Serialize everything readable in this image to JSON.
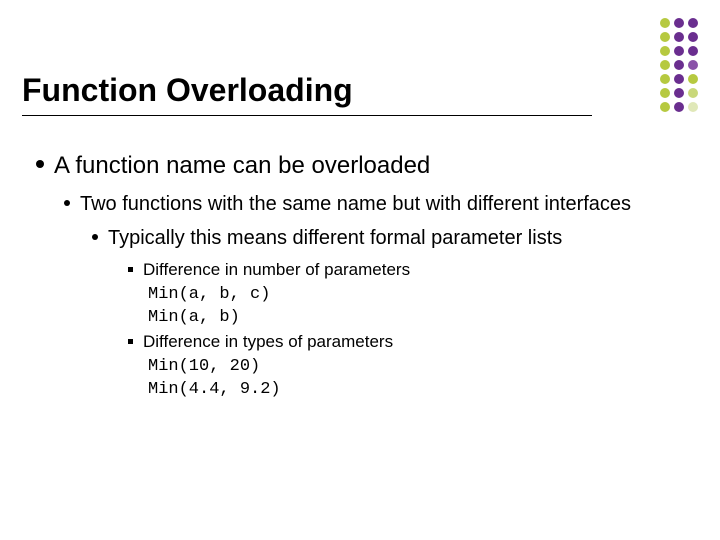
{
  "title": "Function Overloading",
  "l1": "A function name can be overloaded",
  "l2": "Two functions with the same name but with different interfaces",
  "l3": "Typically this means different formal parameter lists",
  "l4a": "Difference in number of parameters",
  "l4a_ex1": "Min(a, b, c)",
  "l4a_ex2": "Min(a, b)",
  "l4b": "Difference in types of parameters",
  "l4b_ex1": "Min(10, 20)",
  "l4b_ex2": "Min(4.4, 9.2)",
  "dot_colors": {
    "col1": [
      "#b6c940",
      "#b6c940",
      "#b6c940",
      "#b6c940",
      "#b6c940",
      "#b6c940",
      "#b6c940"
    ],
    "col2": [
      "#6a2e8f",
      "#6a2e8f",
      "#6a2e8f",
      "#6a2e8f",
      "#6a2e8f",
      "#6a2e8f",
      "#6a2e8f"
    ],
    "col3": [
      "#6a2e8f",
      "#6a2e8f",
      "#6a2e8f",
      "#8a52a8",
      "#b6c940",
      "#c9d87a",
      "#e0e8b8"
    ]
  }
}
